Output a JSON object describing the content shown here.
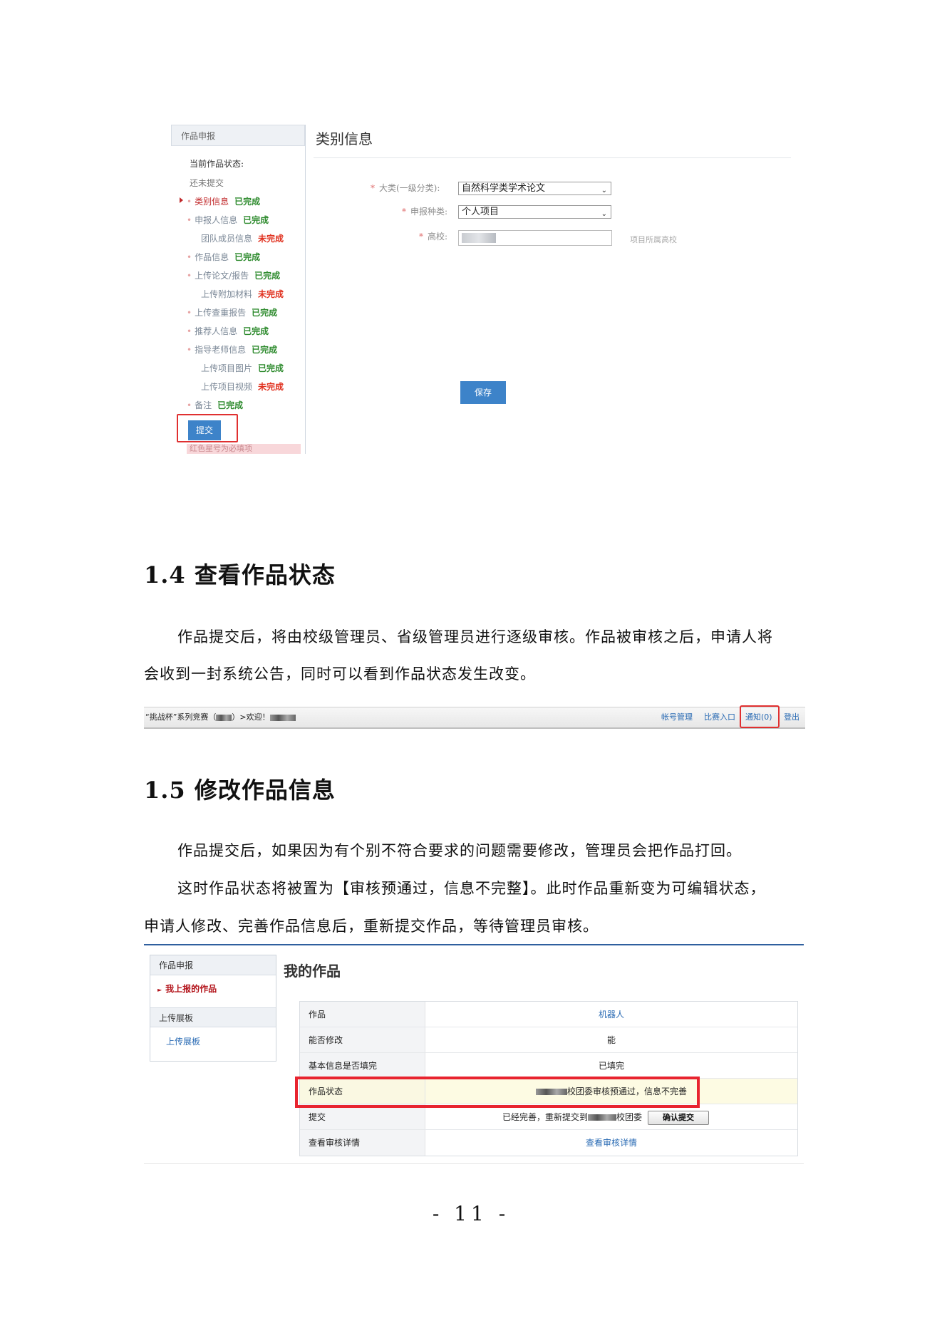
{
  "shot1": {
    "sidebar_title": "作品申报",
    "status_title": "当前作品状态:",
    "status_value": "还未提交",
    "items": [
      {
        "label": "类别信息",
        "status": "已完成",
        "done": true
      },
      {
        "label": "申报人信息",
        "status": "已完成",
        "done": true
      },
      {
        "label": "团队成员信息",
        "status": "未完成",
        "done": false
      },
      {
        "label": "作品信息",
        "status": "已完成",
        "done": true
      },
      {
        "label": "上传论文/报告",
        "status": "已完成",
        "done": true
      },
      {
        "label": "上传附加材料",
        "status": "未完成",
        "done": false
      },
      {
        "label": "上传查重报告",
        "status": "已完成",
        "done": true
      },
      {
        "label": "推荐人信息",
        "status": "已完成",
        "done": true
      },
      {
        "label": "指导老师信息",
        "status": "已完成",
        "done": true
      },
      {
        "label": "上传项目图片",
        "status": "已完成",
        "done": true
      },
      {
        "label": "上传项目视频",
        "status": "未完成",
        "done": false
      },
      {
        "label": "备注",
        "status": "已完成",
        "done": true
      }
    ],
    "submit_label": "提交",
    "required_note": "红色星号为必填项",
    "main_title": "类别信息",
    "form": {
      "category_label": "大类(一级分类):",
      "category_value": "自然科学类学术论文",
      "type_label": "申报种类:",
      "type_value": "个人项目",
      "school_label": "高校:",
      "school_hint": "项目所属高校",
      "save_label": "保存"
    }
  },
  "section14": {
    "heading": "1.4 查看作品状态",
    "para_line1": "作品提交后，将由校级管理员、省级管理员进行逐级审核。作品被审核之后，申请人将",
    "para_line2": "会收到一封系统公告，同时可以看到作品状态发生改变。"
  },
  "shot2": {
    "left_prefix": "“挑战杯”系列竞赛（",
    "left_middle": "）>欢迎！",
    "links": {
      "account": "帐号管理",
      "contest": "比赛入口",
      "notice": "通知(0)",
      "logout": "登出"
    }
  },
  "section15": {
    "heading": "1.5 修改作品信息",
    "para1": "作品提交后，如果因为有个别不符合要求的问题需要修改，管理员会把作品打回。",
    "para2_line1": "这时作品状态将被置为【审核预通过，信息不完整】。此时作品重新变为可编辑状态，",
    "para2_line2": "申请人修改、完善作品信息后，重新提交作品，等待管理员审核。"
  },
  "shot3": {
    "side_head1": "作品申报",
    "side_link1": "我上报的作品",
    "side_head2": "上传展板",
    "side_link2": "上传展板",
    "title": "我的作品",
    "rows": {
      "work_label": "作品",
      "work_value": "机器人",
      "editable_label": "能否修改",
      "editable_value": "能",
      "basic_label": "基本信息是否填完",
      "basic_value": "已填完",
      "status_label": "作品状态",
      "status_value": "校团委审核预通过，信息不完善",
      "submit_label": "提交",
      "submit_prefix": "已经完善，重新提交到",
      "submit_suffix": "校团委",
      "confirm_label": "确认提交",
      "detail_label": "查看审核详情",
      "detail_value": "查看审核详情"
    }
  },
  "page_number": "- 11 -"
}
